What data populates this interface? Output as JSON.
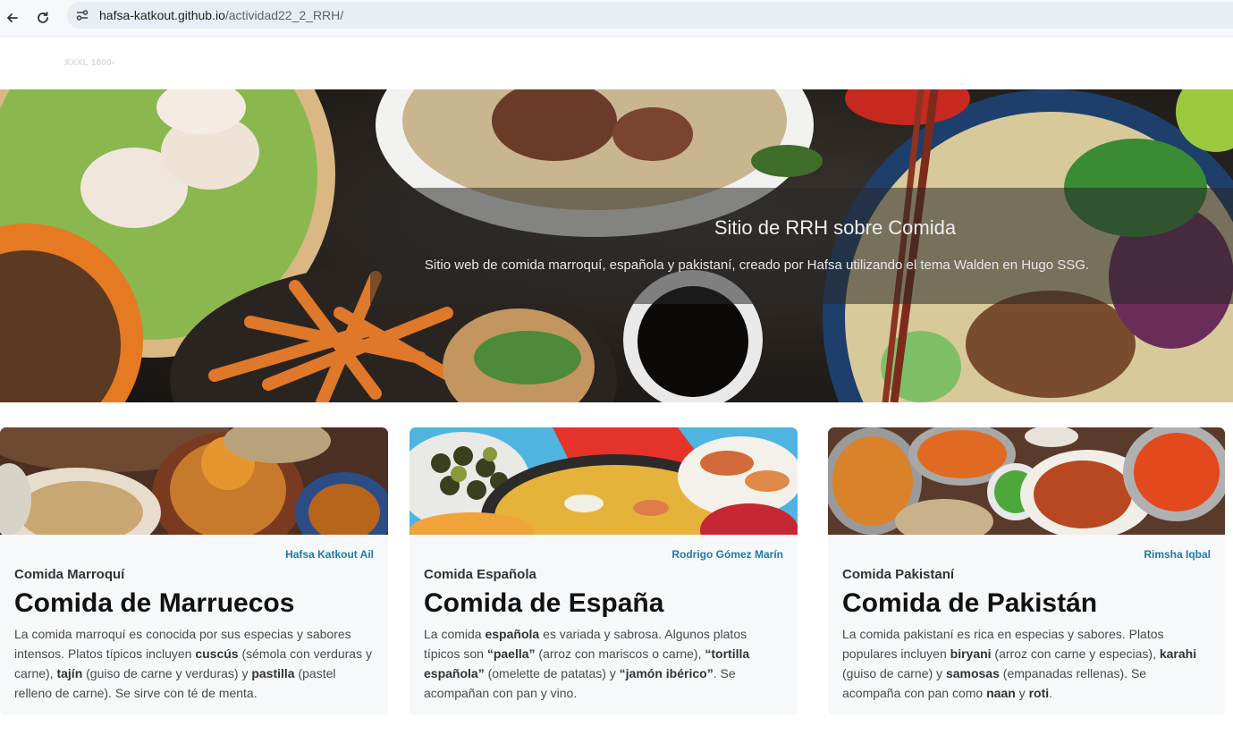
{
  "browser": {
    "url_host": "hafsa-katkout.github.io",
    "url_path": "/actividad22_2_RRH/",
    "icons": [
      "back-arrow-icon",
      "reload-icon",
      "site-info-icon"
    ]
  },
  "site": {
    "logo_text": "XXXL 1800-"
  },
  "hero": {
    "title": "Sitio de RRH sobre Comida",
    "subtitle": "Sitio web de comida marroquí, española y pakistaní, creado por Hafsa utilizando el tema Walden en Hugo SSG."
  },
  "cards": [
    {
      "author": "Hafsa Katkout Ail",
      "category": "Comida Marroquí",
      "title": "Comida de Marruecos",
      "body": [
        {
          "t": "La comida marroquí es conocida por sus especias y sabores intensos. Platos típicos incluyen "
        },
        {
          "b": "cuscús"
        },
        {
          "t": " (sémola con verduras y carne), "
        },
        {
          "b": "tajín"
        },
        {
          "t": " (guiso de carne y verduras) y "
        },
        {
          "b": "pastilla"
        },
        {
          "t": " (pastel relleno de carne). Se sirve con té de menta."
        }
      ]
    },
    {
      "author": "Rodrigo Gómez Marín",
      "category": "Comida Española",
      "title": "Comida de España",
      "body": [
        {
          "t": "La comida "
        },
        {
          "b": "española"
        },
        {
          "t": " es variada y sabrosa. Algunos platos típicos son "
        },
        {
          "b": "“paella”"
        },
        {
          "t": " (arroz con mariscos o carne), "
        },
        {
          "b": "“tortilla española”"
        },
        {
          "t": " (omelette de patatas) y "
        },
        {
          "b": "“jamón ibérico”"
        },
        {
          "t": ". Se acompañan con pan y vino."
        }
      ]
    },
    {
      "author": "Rimsha Iqbal",
      "category": "Comida Pakistaní",
      "title": "Comida de Pakistán",
      "body": [
        {
          "t": "La comida pakistaní es rica en especias y sabores. Platos populares incluyen "
        },
        {
          "b": "biryani"
        },
        {
          "t": " (arroz con carne y especias), "
        },
        {
          "b": "karahi"
        },
        {
          "t": " (guiso de carne) y "
        },
        {
          "b": "samosas"
        },
        {
          "t": " (empanadas rellenas). Se acompaña con pan como "
        },
        {
          "b": "naan"
        },
        {
          "t": " y "
        },
        {
          "b": "roti"
        },
        {
          "t": "."
        }
      ]
    }
  ]
}
